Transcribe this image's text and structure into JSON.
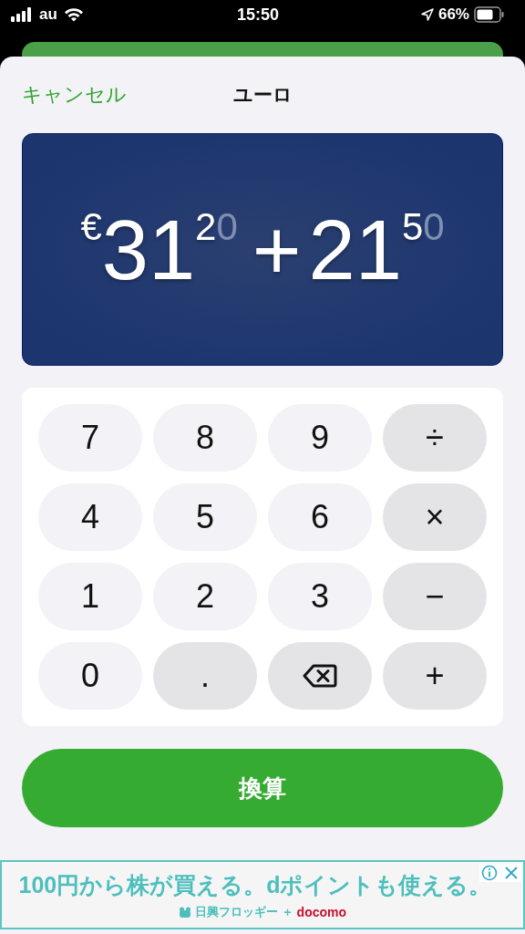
{
  "status_bar": {
    "carrier": "au",
    "time": "15:50",
    "battery": "66%"
  },
  "header": {
    "cancel": "キャンセル",
    "title": "ユーロ"
  },
  "display": {
    "tokens": [
      {
        "kind": "currency",
        "text": "€"
      },
      {
        "kind": "integer",
        "text": "31"
      },
      {
        "kind": "decimal",
        "text": "2"
      },
      {
        "kind": "unentered",
        "text": "0"
      },
      {
        "kind": "operator",
        "text": "+"
      },
      {
        "kind": "integer",
        "text": "21"
      },
      {
        "kind": "decimal",
        "text": "5"
      },
      {
        "kind": "unentered",
        "text": "0"
      }
    ]
  },
  "keypad": [
    {
      "kind": "digit",
      "label": "7"
    },
    {
      "kind": "digit",
      "label": "8"
    },
    {
      "kind": "digit",
      "label": "9"
    },
    {
      "kind": "operator",
      "label": "÷"
    },
    {
      "kind": "digit",
      "label": "4"
    },
    {
      "kind": "digit",
      "label": "5"
    },
    {
      "kind": "digit",
      "label": "6"
    },
    {
      "kind": "operator",
      "label": "×"
    },
    {
      "kind": "digit",
      "label": "1"
    },
    {
      "kind": "digit",
      "label": "2"
    },
    {
      "kind": "digit",
      "label": "3"
    },
    {
      "kind": "operator",
      "label": "−"
    },
    {
      "kind": "digit",
      "label": "0"
    },
    {
      "kind": "operator",
      "label": "."
    },
    {
      "kind": "backspace"
    },
    {
      "kind": "operator",
      "label": "+"
    }
  ],
  "convert_button": "換算",
  "ad": {
    "headline": "100円から株が買える。dポイントも使える。",
    "brand": "日興フロッギー ＋",
    "partner": "docomo"
  }
}
